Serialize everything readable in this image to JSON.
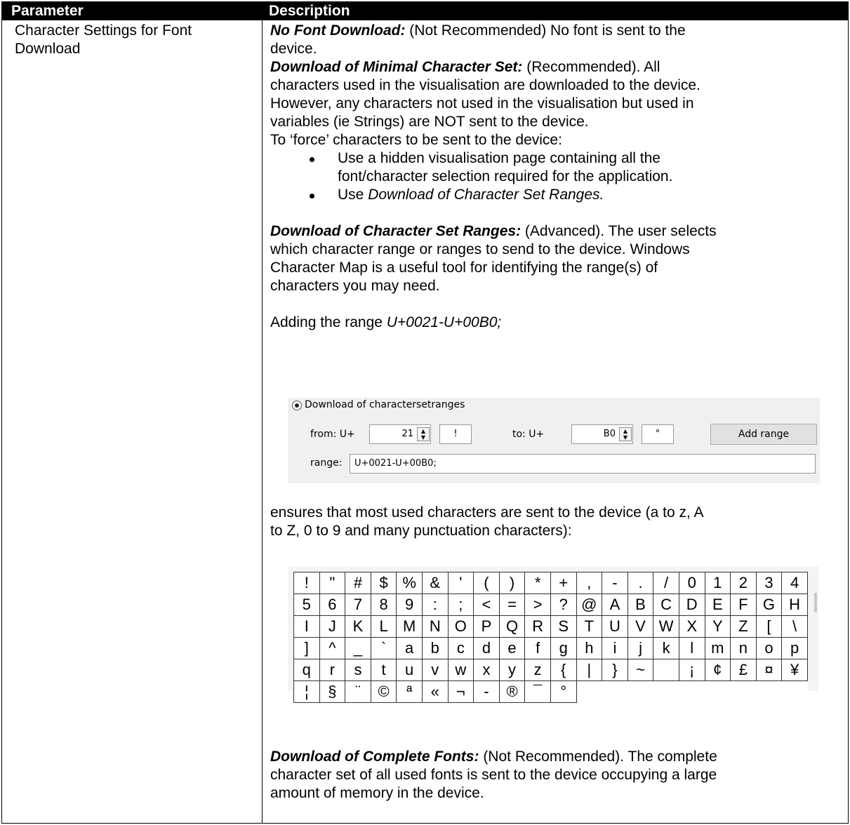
{
  "header": {
    "parameter": "Parameter",
    "description": "Description"
  },
  "row": {
    "parameter_line1": "Character Settings for Font",
    "parameter_line2": "Download",
    "no_font_title": "No Font Download:",
    "no_font_text": " (Not Recommended) No font is sent to the",
    "no_font_text2": "device.",
    "minimal_title": "Download of Minimal Character Set:",
    "minimal_text": " (Recommended). All",
    "minimal_line2": "characters used in the visualisation are downloaded to the device.",
    "minimal_line3": "However, any characters not used in the visualisation but used in",
    "minimal_line4": "variables (ie Strings) are NOT sent to the device.",
    "force_line": "To ‘force’ characters to be sent to the device:",
    "bullet1_line1": "Use a hidden visualisation page containing all the",
    "bullet1_line2": "font/character selection required for the application.",
    "bullet2_prefix": "Use ",
    "bullet2_italic": "Download of Character Set Ranges.",
    "ranges_title": "Download of Character Set Ranges:",
    "ranges_text": " (Advanced). The user selects",
    "ranges_line2": "which character range or ranges to send to the device. Windows",
    "ranges_line3": "Character Map is a useful tool for identifying the range(s) of",
    "ranges_line4": "characters you may need.",
    "adding_prefix": "Adding the range ",
    "adding_italic": "U+0021-U+00B0;",
    "ensures_line1": "ensures that most used characters are sent to the device (a to z, A",
    "ensures_line2": "to Z, 0 to 9 and many punctuation characters):",
    "complete_title": "Download of Complete Fonts:",
    "complete_text": " (Not Recommended). The complete",
    "complete_line2": "character set of all used fonts is sent to the device occupying a large",
    "complete_line3": "amount of memory in the device."
  },
  "dialog": {
    "radio_label": "Download of charactersetranges",
    "from_label": "from: U+",
    "from_value": "21",
    "from_char": "!",
    "to_label": "to:  U+",
    "to_value": "B0",
    "to_char": "°",
    "add_button": "Add range",
    "range_label": "range:",
    "range_value": "U+0021-U+00B0;"
  },
  "charmap": {
    "cells": [
      "!",
      "\"",
      "#",
      "$",
      "%",
      "&",
      "'",
      "(",
      ")",
      "*",
      "+",
      ",",
      "-",
      ".",
      "/",
      "0",
      "1",
      "2",
      "3",
      "4",
      "5",
      "6",
      "7",
      "8",
      "9",
      ":",
      ";",
      "<",
      "=",
      ">",
      "?",
      "@",
      "A",
      "B",
      "C",
      "D",
      "E",
      "F",
      "G",
      "H",
      "I",
      "J",
      "K",
      "L",
      "M",
      "N",
      "O",
      "P",
      "Q",
      "R",
      "S",
      "T",
      "U",
      "V",
      "W",
      "X",
      "Y",
      "Z",
      "[",
      "\\",
      "]",
      "^",
      "_",
      "`",
      "a",
      "b",
      "c",
      "d",
      "e",
      "f",
      "g",
      "h",
      "i",
      "j",
      "k",
      "l",
      "m",
      "n",
      "o",
      "p",
      "q",
      "r",
      "s",
      "t",
      "u",
      "v",
      "w",
      "x",
      "y",
      "z",
      "{",
      "|",
      "}",
      "~",
      " ",
      "¡",
      "¢",
      "£",
      "¤",
      "¥",
      "¦",
      "§",
      "¨",
      "©",
      "ª",
      "«",
      "¬",
      "-",
      "®",
      "¯",
      "°"
    ]
  }
}
